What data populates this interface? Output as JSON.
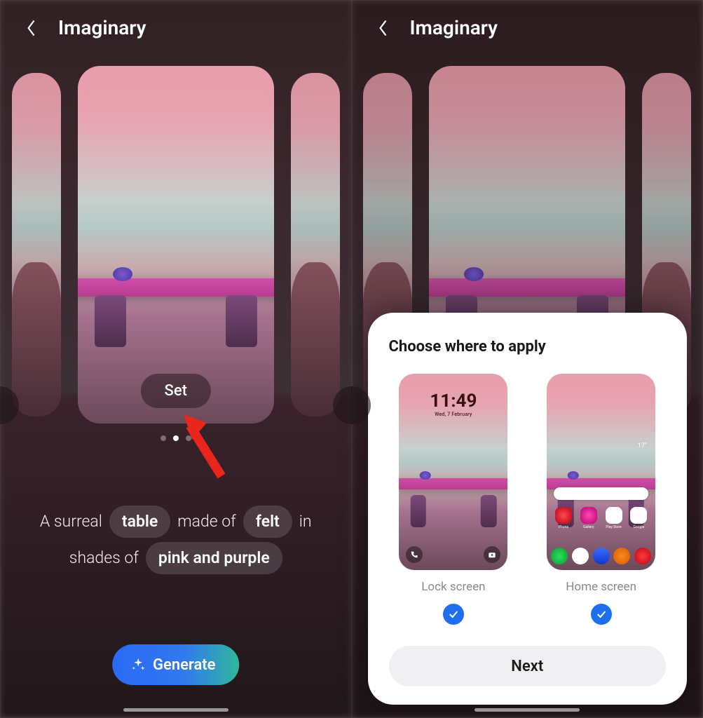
{
  "app": {
    "title": "Imaginary"
  },
  "left": {
    "set_label": "Set",
    "dots_active_index": 1,
    "dots_count": 3,
    "prompt": {
      "t0": "A surreal",
      "c0": "table",
      "t1": "made of",
      "c1": "felt",
      "t2": "in",
      "t3": "shades of",
      "c2": "pink and purple"
    },
    "generate_label": "Generate"
  },
  "right": {
    "sheet_title": "Choose where to apply",
    "options": {
      "lock": {
        "label": "Lock screen",
        "time": "11:49",
        "date": "Wed, 7 February",
        "checked": true
      },
      "home": {
        "label": "Home screen",
        "weather": "17°",
        "checked": true,
        "apps_r1": [
          "Phone",
          "Gallery",
          "Play Store",
          "Google"
        ],
        "dock_count": 5
      }
    },
    "next_label": "Next"
  },
  "icons": {
    "back": "chevron-left",
    "sparkle": "sparkle",
    "check": "check",
    "phone": "phone",
    "camera": "camera"
  },
  "colors": {
    "accent_blue": "#1f6ef0",
    "gen_gradient_start": "#2a6af5",
    "gen_gradient_end": "#2fb89a",
    "arrow_red": "#e8261c"
  }
}
